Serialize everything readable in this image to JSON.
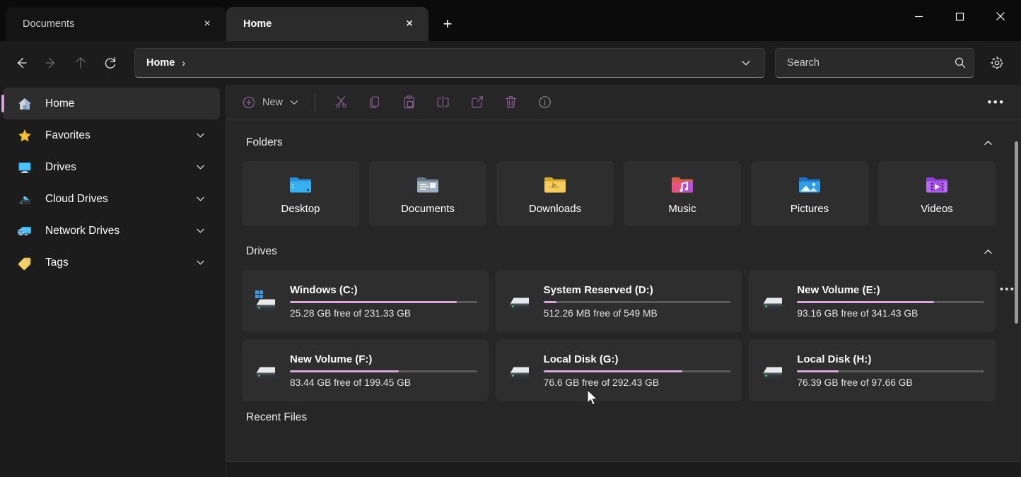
{
  "window": {
    "tabs": [
      {
        "label": "Documents",
        "active": false,
        "close": "×"
      },
      {
        "label": "Home",
        "active": true,
        "close": "×"
      }
    ],
    "new_tab_label": "+",
    "controls": {
      "minimize": "minimize-icon",
      "maximize": "maximize-icon",
      "close": "close-icon"
    }
  },
  "address": {
    "back": "back-arrow-icon",
    "forward": "forward-arrow-icon",
    "up": "up-arrow-icon",
    "refresh": "refresh-icon",
    "breadcrumb": "Home",
    "breadcrumb_separator": "›",
    "dropdown": "chevron-down-icon"
  },
  "search": {
    "placeholder": "Search",
    "value": "",
    "icon": "search-icon"
  },
  "settings_icon": "gear-icon",
  "sidebar": {
    "items": [
      {
        "label": "Home",
        "icon": "home-icon",
        "selected": true,
        "caret": false
      },
      {
        "label": "Favorites",
        "icon": "star-icon",
        "selected": false,
        "caret": true
      },
      {
        "label": "Drives",
        "icon": "monitor-icon",
        "selected": false,
        "caret": true
      },
      {
        "label": "Cloud Drives",
        "icon": "cloud-drive-icon",
        "selected": false,
        "caret": true
      },
      {
        "label": "Network Drives",
        "icon": "network-drive-icon",
        "selected": false,
        "caret": true
      },
      {
        "label": "Tags",
        "icon": "tag-icon",
        "selected": false,
        "caret": true
      }
    ]
  },
  "toolbar": {
    "new_label": "New",
    "new_icon": "plus-circle-icon",
    "new_caret": "chevron-down-icon",
    "actions": [
      {
        "name": "cut-icon",
        "title": "Cut"
      },
      {
        "name": "copy-icon",
        "title": "Copy"
      },
      {
        "name": "paste-icon",
        "title": "Paste"
      },
      {
        "name": "rename-icon",
        "title": "Rename"
      },
      {
        "name": "share-icon",
        "title": "Share"
      },
      {
        "name": "delete-icon",
        "title": "Delete"
      },
      {
        "name": "properties-icon",
        "title": "Properties"
      }
    ],
    "overflow": "•••"
  },
  "sections": {
    "folders": {
      "title": "Folders",
      "caret": "chevron-up-icon",
      "items": [
        {
          "label": "Desktop",
          "icon": "folder-desktop-icon"
        },
        {
          "label": "Documents",
          "icon": "folder-documents-icon"
        },
        {
          "label": "Downloads",
          "icon": "folder-downloads-icon"
        },
        {
          "label": "Music",
          "icon": "folder-music-icon"
        },
        {
          "label": "Pictures",
          "icon": "folder-pictures-icon"
        },
        {
          "label": "Videos",
          "icon": "folder-videos-icon"
        }
      ]
    },
    "drives": {
      "title": "Drives",
      "caret": "chevron-up-icon",
      "overflow": "•••",
      "items": [
        {
          "name": "Windows (C:)",
          "free": "25.28 GB free of 231.33 GB",
          "used_percent": 89,
          "icon": "windows-drive-icon"
        },
        {
          "name": "System Reserved (D:)",
          "free": "512.26 MB free of 549 MB",
          "used_percent": 7,
          "icon": "drive-icon"
        },
        {
          "name": "New Volume (E:)",
          "free": "93.16 GB free of 341.43 GB",
          "used_percent": 73,
          "icon": "drive-icon"
        },
        {
          "name": "New Volume (F:)",
          "free": "83.44 GB free of 199.45 GB",
          "used_percent": 58,
          "icon": "drive-icon"
        },
        {
          "name": "Local Disk (G:)",
          "free": "76.6 GB free of 292.43 GB",
          "used_percent": 74,
          "icon": "drive-icon"
        },
        {
          "name": "Local Disk (H:)",
          "free": "76.39 GB free of 97.66 GB",
          "used_percent": 22,
          "icon": "drive-icon"
        }
      ]
    },
    "recent": {
      "title": "Recent Files"
    }
  },
  "colors": {
    "accent": "#d7a3d9",
    "progress": "#d9a6dd",
    "toolbar_icon": "#8b5f96",
    "window_bg": "#1c1c1c",
    "content_bg": "#262626",
    "card_bg": "#2e2e2e"
  }
}
